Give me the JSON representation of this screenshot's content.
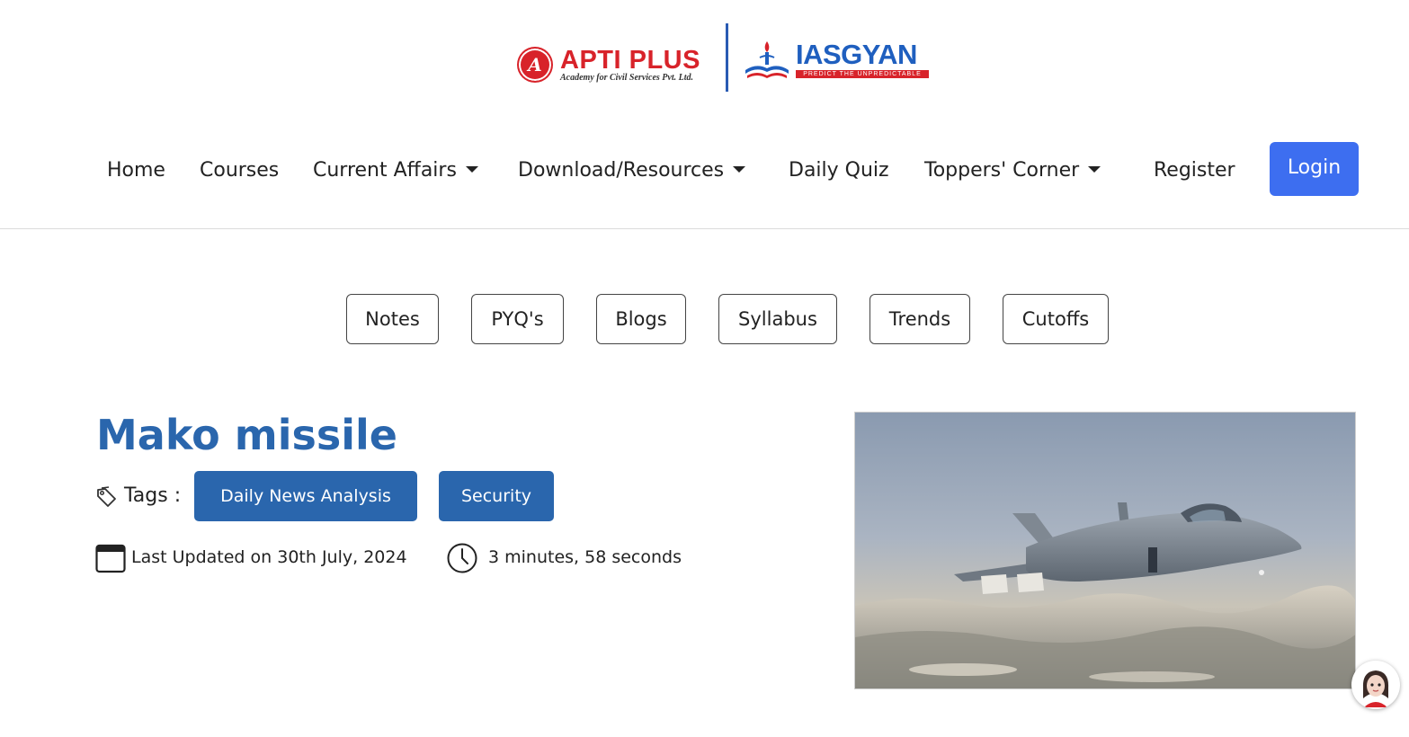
{
  "logo": {
    "apti_title": "APTI PLUS",
    "apti_subtitle": "Academy for Civil Services Pvt. Ltd.",
    "apti_emblem_glyph": "A",
    "ias_title": "IASGYAN",
    "ias_tagline": "PREDICT THE UNPREDICTABLE"
  },
  "nav": {
    "items": [
      {
        "label": "Home",
        "dropdown": false
      },
      {
        "label": "Courses",
        "dropdown": false
      },
      {
        "label": "Current Affairs",
        "dropdown": true
      },
      {
        "label": "Download/Resources",
        "dropdown": true
      },
      {
        "label": "Daily Quiz",
        "dropdown": false
      },
      {
        "label": "Toppers' Corner",
        "dropdown": true
      },
      {
        "label": "Register",
        "dropdown": false
      }
    ],
    "login_label": "Login"
  },
  "chips": [
    "Notes",
    "PYQ's",
    "Blogs",
    "Syllabus",
    "Trends",
    "Cutoffs"
  ],
  "article": {
    "title": "Mako missile",
    "tags_label": "Tags :",
    "tags": [
      "Daily News Analysis",
      "Security"
    ],
    "last_updated": "Last Updated on 30th July, 2024",
    "read_time": "3 minutes, 58 seconds"
  },
  "icons": {
    "tag": "tag-icon",
    "calendar": "calendar-icon",
    "clock": "clock-icon",
    "caret": "chevron-down-icon"
  },
  "colors": {
    "brand_red": "#d8232a",
    "brand_blue": "#2a66ad",
    "login_blue": "#3d6ef0"
  }
}
